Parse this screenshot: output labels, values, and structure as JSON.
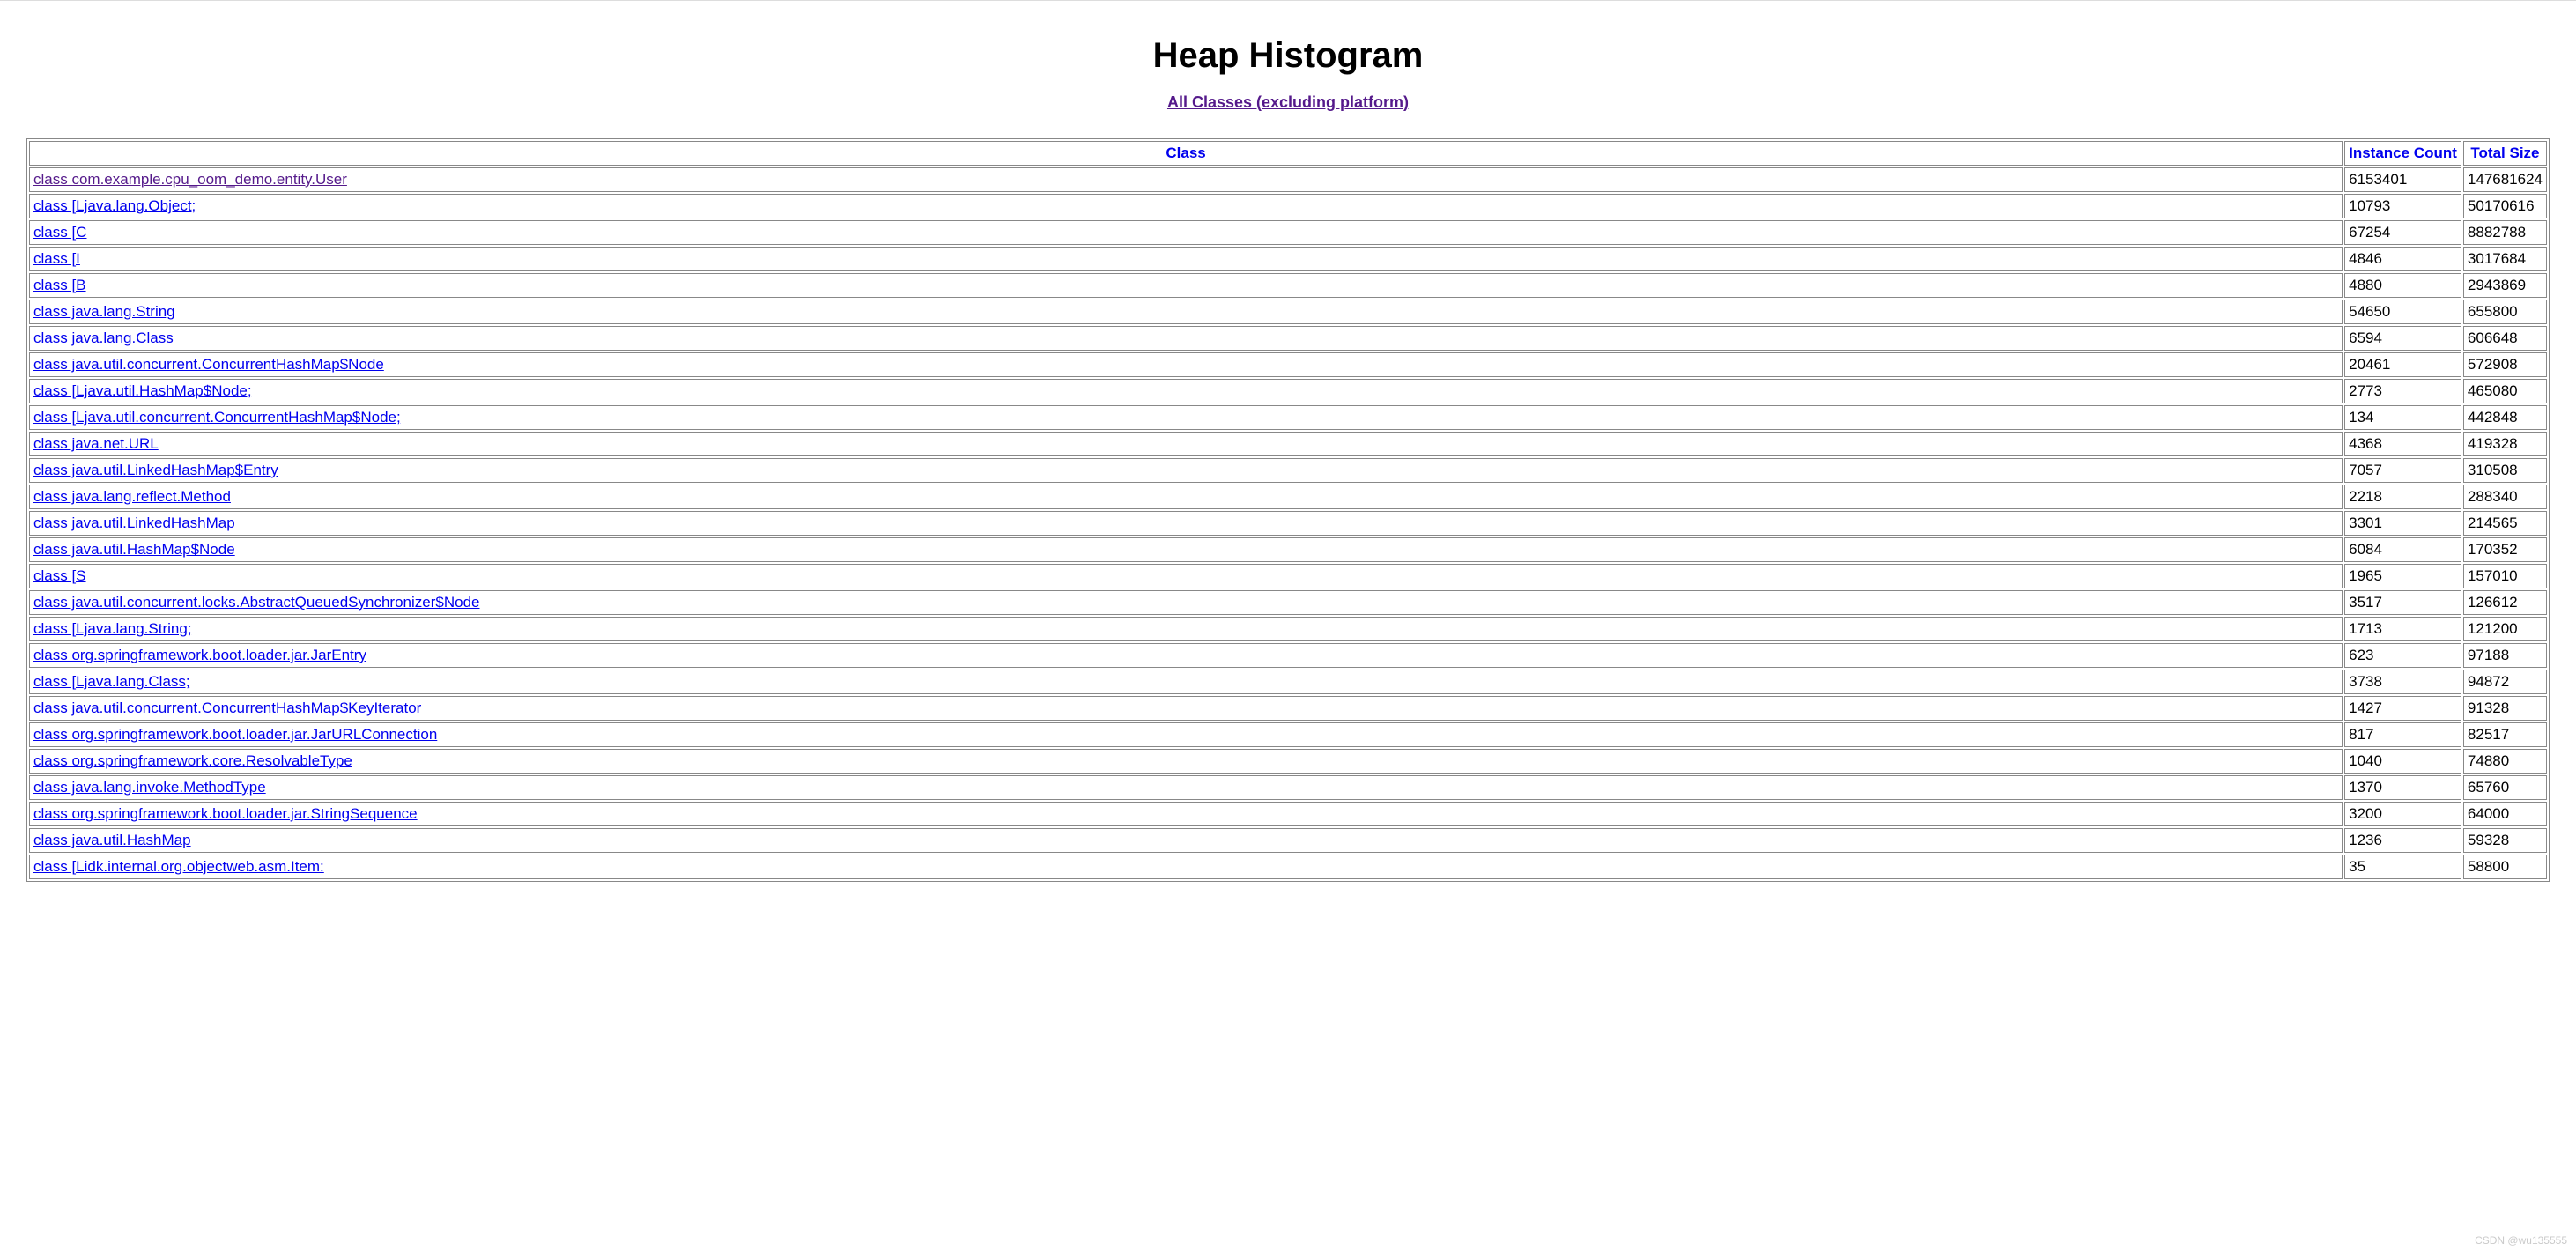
{
  "page": {
    "title": "Heap Histogram",
    "subtitle_link": "All Classes (excluding platform)"
  },
  "table": {
    "headers": {
      "class": "Class",
      "instance_count": "Instance Count",
      "total_size": "Total Size"
    },
    "rows": [
      {
        "class": "class com.example.cpu_oom_demo.entity.User",
        "count": "6153401",
        "size": "147681624",
        "visited": true
      },
      {
        "class": "class [Ljava.lang.Object;",
        "count": "10793",
        "size": "50170616",
        "visited": false
      },
      {
        "class": "class [C",
        "count": "67254",
        "size": "8882788",
        "visited": false
      },
      {
        "class": "class [I",
        "count": "4846",
        "size": "3017684",
        "visited": false
      },
      {
        "class": "class [B",
        "count": "4880",
        "size": "2943869",
        "visited": false
      },
      {
        "class": "class java.lang.String",
        "count": "54650",
        "size": "655800",
        "visited": false
      },
      {
        "class": "class java.lang.Class",
        "count": "6594",
        "size": "606648",
        "visited": false
      },
      {
        "class": "class java.util.concurrent.ConcurrentHashMap$Node",
        "count": "20461",
        "size": "572908",
        "visited": false
      },
      {
        "class": "class [Ljava.util.HashMap$Node;",
        "count": "2773",
        "size": "465080",
        "visited": false
      },
      {
        "class": "class [Ljava.util.concurrent.ConcurrentHashMap$Node;",
        "count": "134",
        "size": "442848",
        "visited": false
      },
      {
        "class": "class java.net.URL",
        "count": "4368",
        "size": "419328",
        "visited": false
      },
      {
        "class": "class java.util.LinkedHashMap$Entry",
        "count": "7057",
        "size": "310508",
        "visited": false
      },
      {
        "class": "class java.lang.reflect.Method",
        "count": "2218",
        "size": "288340",
        "visited": false
      },
      {
        "class": "class java.util.LinkedHashMap",
        "count": "3301",
        "size": "214565",
        "visited": false
      },
      {
        "class": "class java.util.HashMap$Node",
        "count": "6084",
        "size": "170352",
        "visited": false
      },
      {
        "class": "class [S",
        "count": "1965",
        "size": "157010",
        "visited": false
      },
      {
        "class": "class java.util.concurrent.locks.AbstractQueuedSynchronizer$Node",
        "count": "3517",
        "size": "126612",
        "visited": false
      },
      {
        "class": "class [Ljava.lang.String;",
        "count": "1713",
        "size": "121200",
        "visited": false
      },
      {
        "class": "class org.springframework.boot.loader.jar.JarEntry",
        "count": "623",
        "size": "97188",
        "visited": false
      },
      {
        "class": "class [Ljava.lang.Class;",
        "count": "3738",
        "size": "94872",
        "visited": false
      },
      {
        "class": "class java.util.concurrent.ConcurrentHashMap$KeyIterator",
        "count": "1427",
        "size": "91328",
        "visited": false
      },
      {
        "class": "class org.springframework.boot.loader.jar.JarURLConnection",
        "count": "817",
        "size": "82517",
        "visited": false
      },
      {
        "class": "class org.springframework.core.ResolvableType",
        "count": "1040",
        "size": "74880",
        "visited": false
      },
      {
        "class": "class java.lang.invoke.MethodType",
        "count": "1370",
        "size": "65760",
        "visited": false
      },
      {
        "class": "class org.springframework.boot.loader.jar.StringSequence",
        "count": "3200",
        "size": "64000",
        "visited": false
      },
      {
        "class": "class java.util.HashMap",
        "count": "1236",
        "size": "59328",
        "visited": false
      },
      {
        "class": "class [Lidk.internal.org.objectweb.asm.Item:",
        "count": "35",
        "size": "58800",
        "visited": false
      }
    ]
  },
  "watermark": "CSDN @wu135555"
}
